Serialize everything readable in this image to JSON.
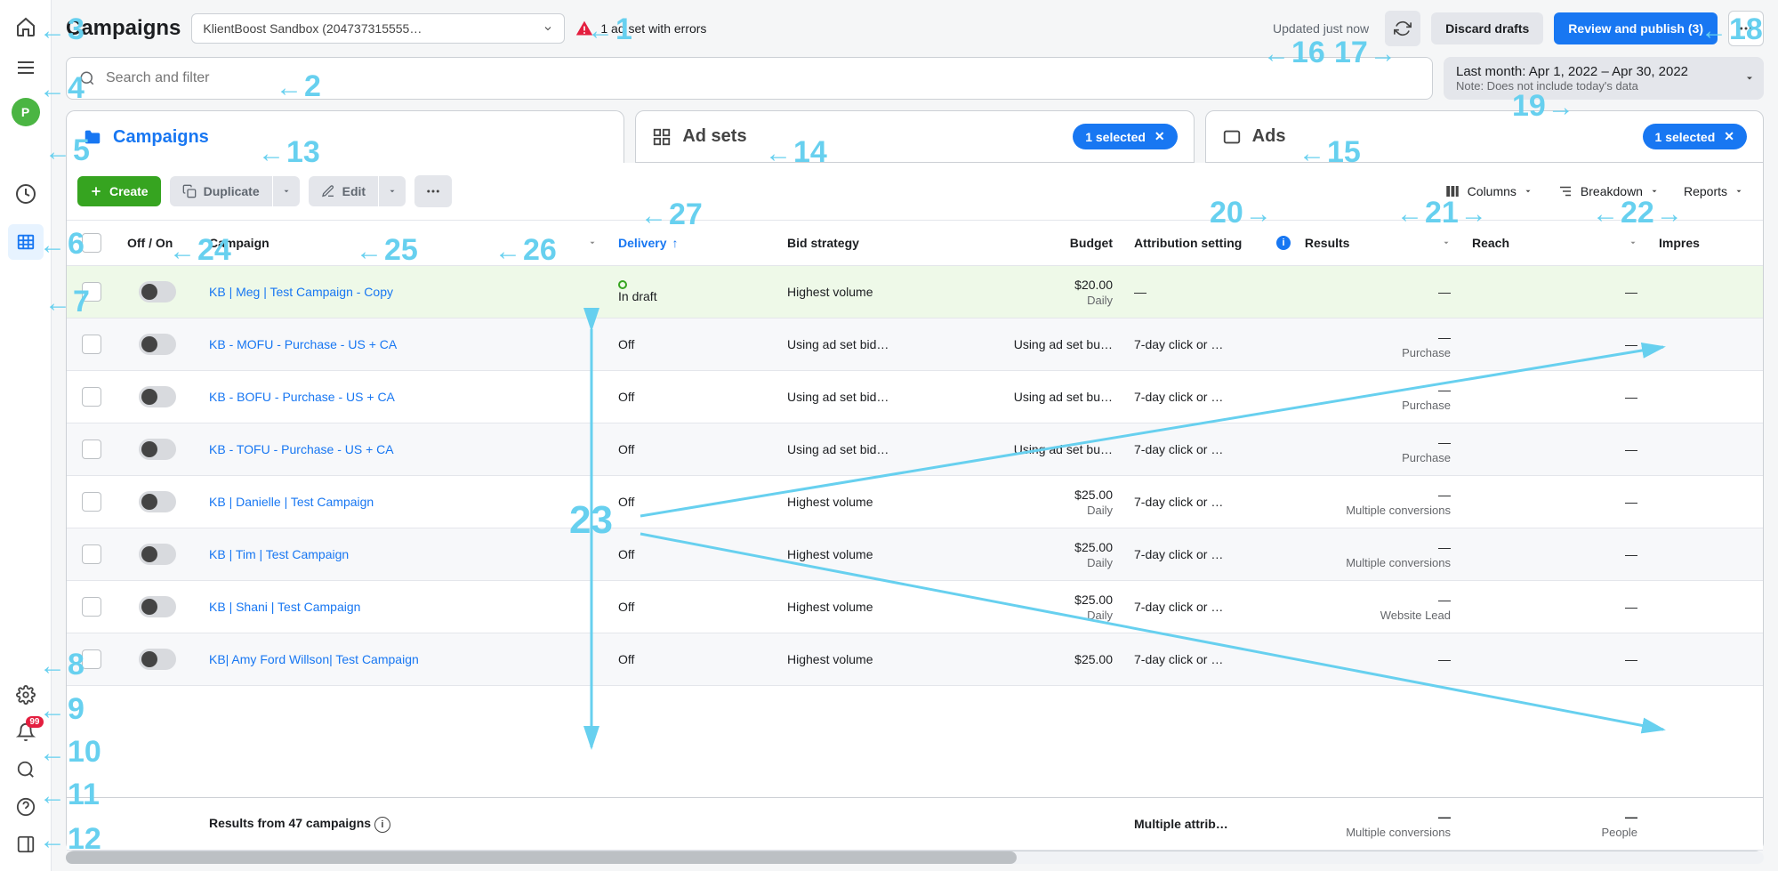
{
  "header": {
    "title": "Campaigns",
    "account_label": "KlientBoost Sandbox (204737315555…",
    "error_text": "1 ad set with errors",
    "updated_text": "Updated just now",
    "discard_label": "Discard drafts",
    "publish_label": "Review and publish (3)"
  },
  "search": {
    "placeholder": "Search and filter"
  },
  "date": {
    "range": "Last month: Apr 1, 2022 – Apr 30, 2022",
    "note": "Note: Does not include today's data"
  },
  "leftnav": {
    "avatar_letter": "P",
    "notif_badge": "99"
  },
  "tabs": {
    "campaigns": "Campaigns",
    "adsets": "Ad sets",
    "ads": "Ads",
    "selected_label": "1 selected"
  },
  "toolbar": {
    "create": "Create",
    "duplicate": "Duplicate",
    "edit": "Edit",
    "columns": "Columns",
    "breakdown": "Breakdown",
    "reports": "Reports"
  },
  "columns": {
    "offon": "Off / On",
    "campaign": "Campaign",
    "delivery": "Delivery",
    "bid": "Bid strategy",
    "budget": "Budget",
    "attrib": "Attribution setting",
    "results": "Results",
    "reach": "Reach",
    "impressions": "Impres"
  },
  "rows": [
    {
      "name": "KB | Meg | Test Campaign - Copy",
      "delivery": "In draft",
      "delivery_draft": true,
      "bid": "Highest volume",
      "budget": "$20.00",
      "budget_sub": "Daily",
      "attrib": "—",
      "results": "—",
      "results_sub": "",
      "reach": "—",
      "draft": true
    },
    {
      "name": "KB - MOFU - Purchase - US + CA",
      "delivery": "Off",
      "bid": "Using ad set bid…",
      "budget": "Using ad set bu…",
      "attrib": "7-day click or …",
      "results": "—",
      "results_sub": "Purchase",
      "reach": "—"
    },
    {
      "name": "KB - BOFU - Purchase - US + CA",
      "delivery": "Off",
      "bid": "Using ad set bid…",
      "budget": "Using ad set bu…",
      "attrib": "7-day click or …",
      "results": "—",
      "results_sub": "Purchase",
      "reach": "—"
    },
    {
      "name": "KB - TOFU - Purchase - US + CA",
      "delivery": "Off",
      "bid": "Using ad set bid…",
      "budget": "Using ad set bu…",
      "attrib": "7-day click or …",
      "results": "—",
      "results_sub": "Purchase",
      "reach": "—"
    },
    {
      "name": "KB | Danielle | Test Campaign",
      "delivery": "Off",
      "bid": "Highest volume",
      "budget": "$25.00",
      "budget_sub": "Daily",
      "attrib": "7-day click or …",
      "results": "—",
      "results_sub": "Multiple conversions",
      "reach": "—"
    },
    {
      "name": "KB | Tim | Test Campaign",
      "delivery": "Off",
      "bid": "Highest volume",
      "budget": "$25.00",
      "budget_sub": "Daily",
      "attrib": "7-day click or …",
      "results": "—",
      "results_sub": "Multiple conversions",
      "reach": "—"
    },
    {
      "name": "KB | Shani | Test Campaign",
      "delivery": "Off",
      "bid": "Highest volume",
      "budget": "$25.00",
      "budget_sub": "Daily",
      "attrib": "7-day click or …",
      "results": "—",
      "results_sub": "Website Lead",
      "reach": "—"
    },
    {
      "name": "KB| Amy Ford Willson| Test Campaign",
      "delivery": "Off",
      "bid": "Highest volume",
      "budget": "$25.00",
      "attrib": "7-day click or …",
      "results": "—",
      "reach": "—"
    }
  ],
  "footer": {
    "label": "Results from 47 campaigns",
    "attrib": "Multiple attrib…",
    "results": "—",
    "results_sub": "Multiple conversions",
    "reach": "—",
    "reach_sub": "People"
  },
  "annotations": {
    "1": "1",
    "2": "2",
    "3": "3",
    "4": "4",
    "5": "5",
    "6": "6",
    "7": "7",
    "8": "8",
    "9": "9",
    "10": "10",
    "11": "11",
    "12": "12",
    "13": "13",
    "14": "14",
    "15": "15",
    "16": "16",
    "17": "17",
    "18": "18",
    "19": "19",
    "20": "20",
    "21": "21",
    "22": "22",
    "23": "23",
    "24": "24",
    "25": "25",
    "26": "26",
    "27": "27"
  }
}
